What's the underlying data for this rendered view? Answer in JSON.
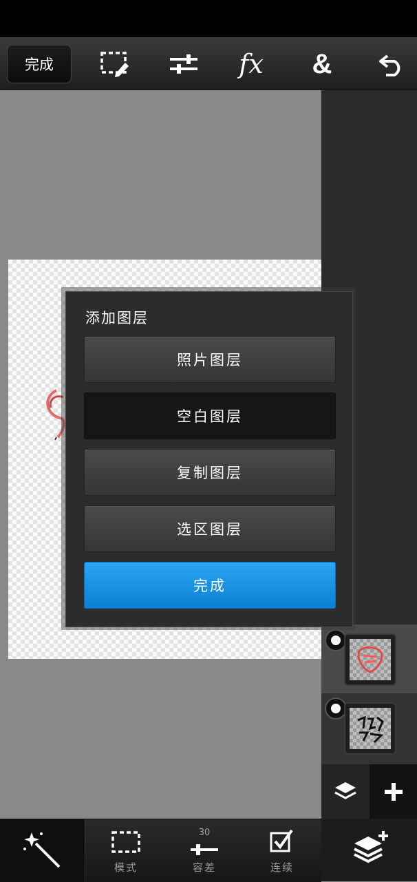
{
  "toolbar": {
    "done_label": "完成",
    "icons": [
      "selection-edit-icon",
      "adjustments-icon",
      "fx-icon",
      "blend-icon",
      "undo-icon"
    ],
    "fx_label": "fx",
    "blend_label": "&"
  },
  "dialog": {
    "title": "添加图层",
    "buttons": [
      {
        "label": "照片图层",
        "state": "normal"
      },
      {
        "label": "空白图层",
        "state": "selected"
      },
      {
        "label": "复制图层",
        "state": "normal"
      },
      {
        "label": "选区图层",
        "state": "normal"
      }
    ],
    "done_label": "完成",
    "accent": "#1a94e6"
  },
  "layers": {
    "items": [
      {
        "name": "layer-1",
        "selected": true
      },
      {
        "name": "layer-2",
        "selected": false
      }
    ]
  },
  "bottom_toolbar": {
    "tools": [
      {
        "icon": "magic-wand-icon",
        "label": ""
      },
      {
        "icon": "marquee-icon",
        "label": "模式"
      },
      {
        "icon": "tolerance-slider-icon",
        "label": "容差",
        "value": "30"
      },
      {
        "icon": "contiguous-check-icon",
        "label": "连续"
      }
    ]
  }
}
